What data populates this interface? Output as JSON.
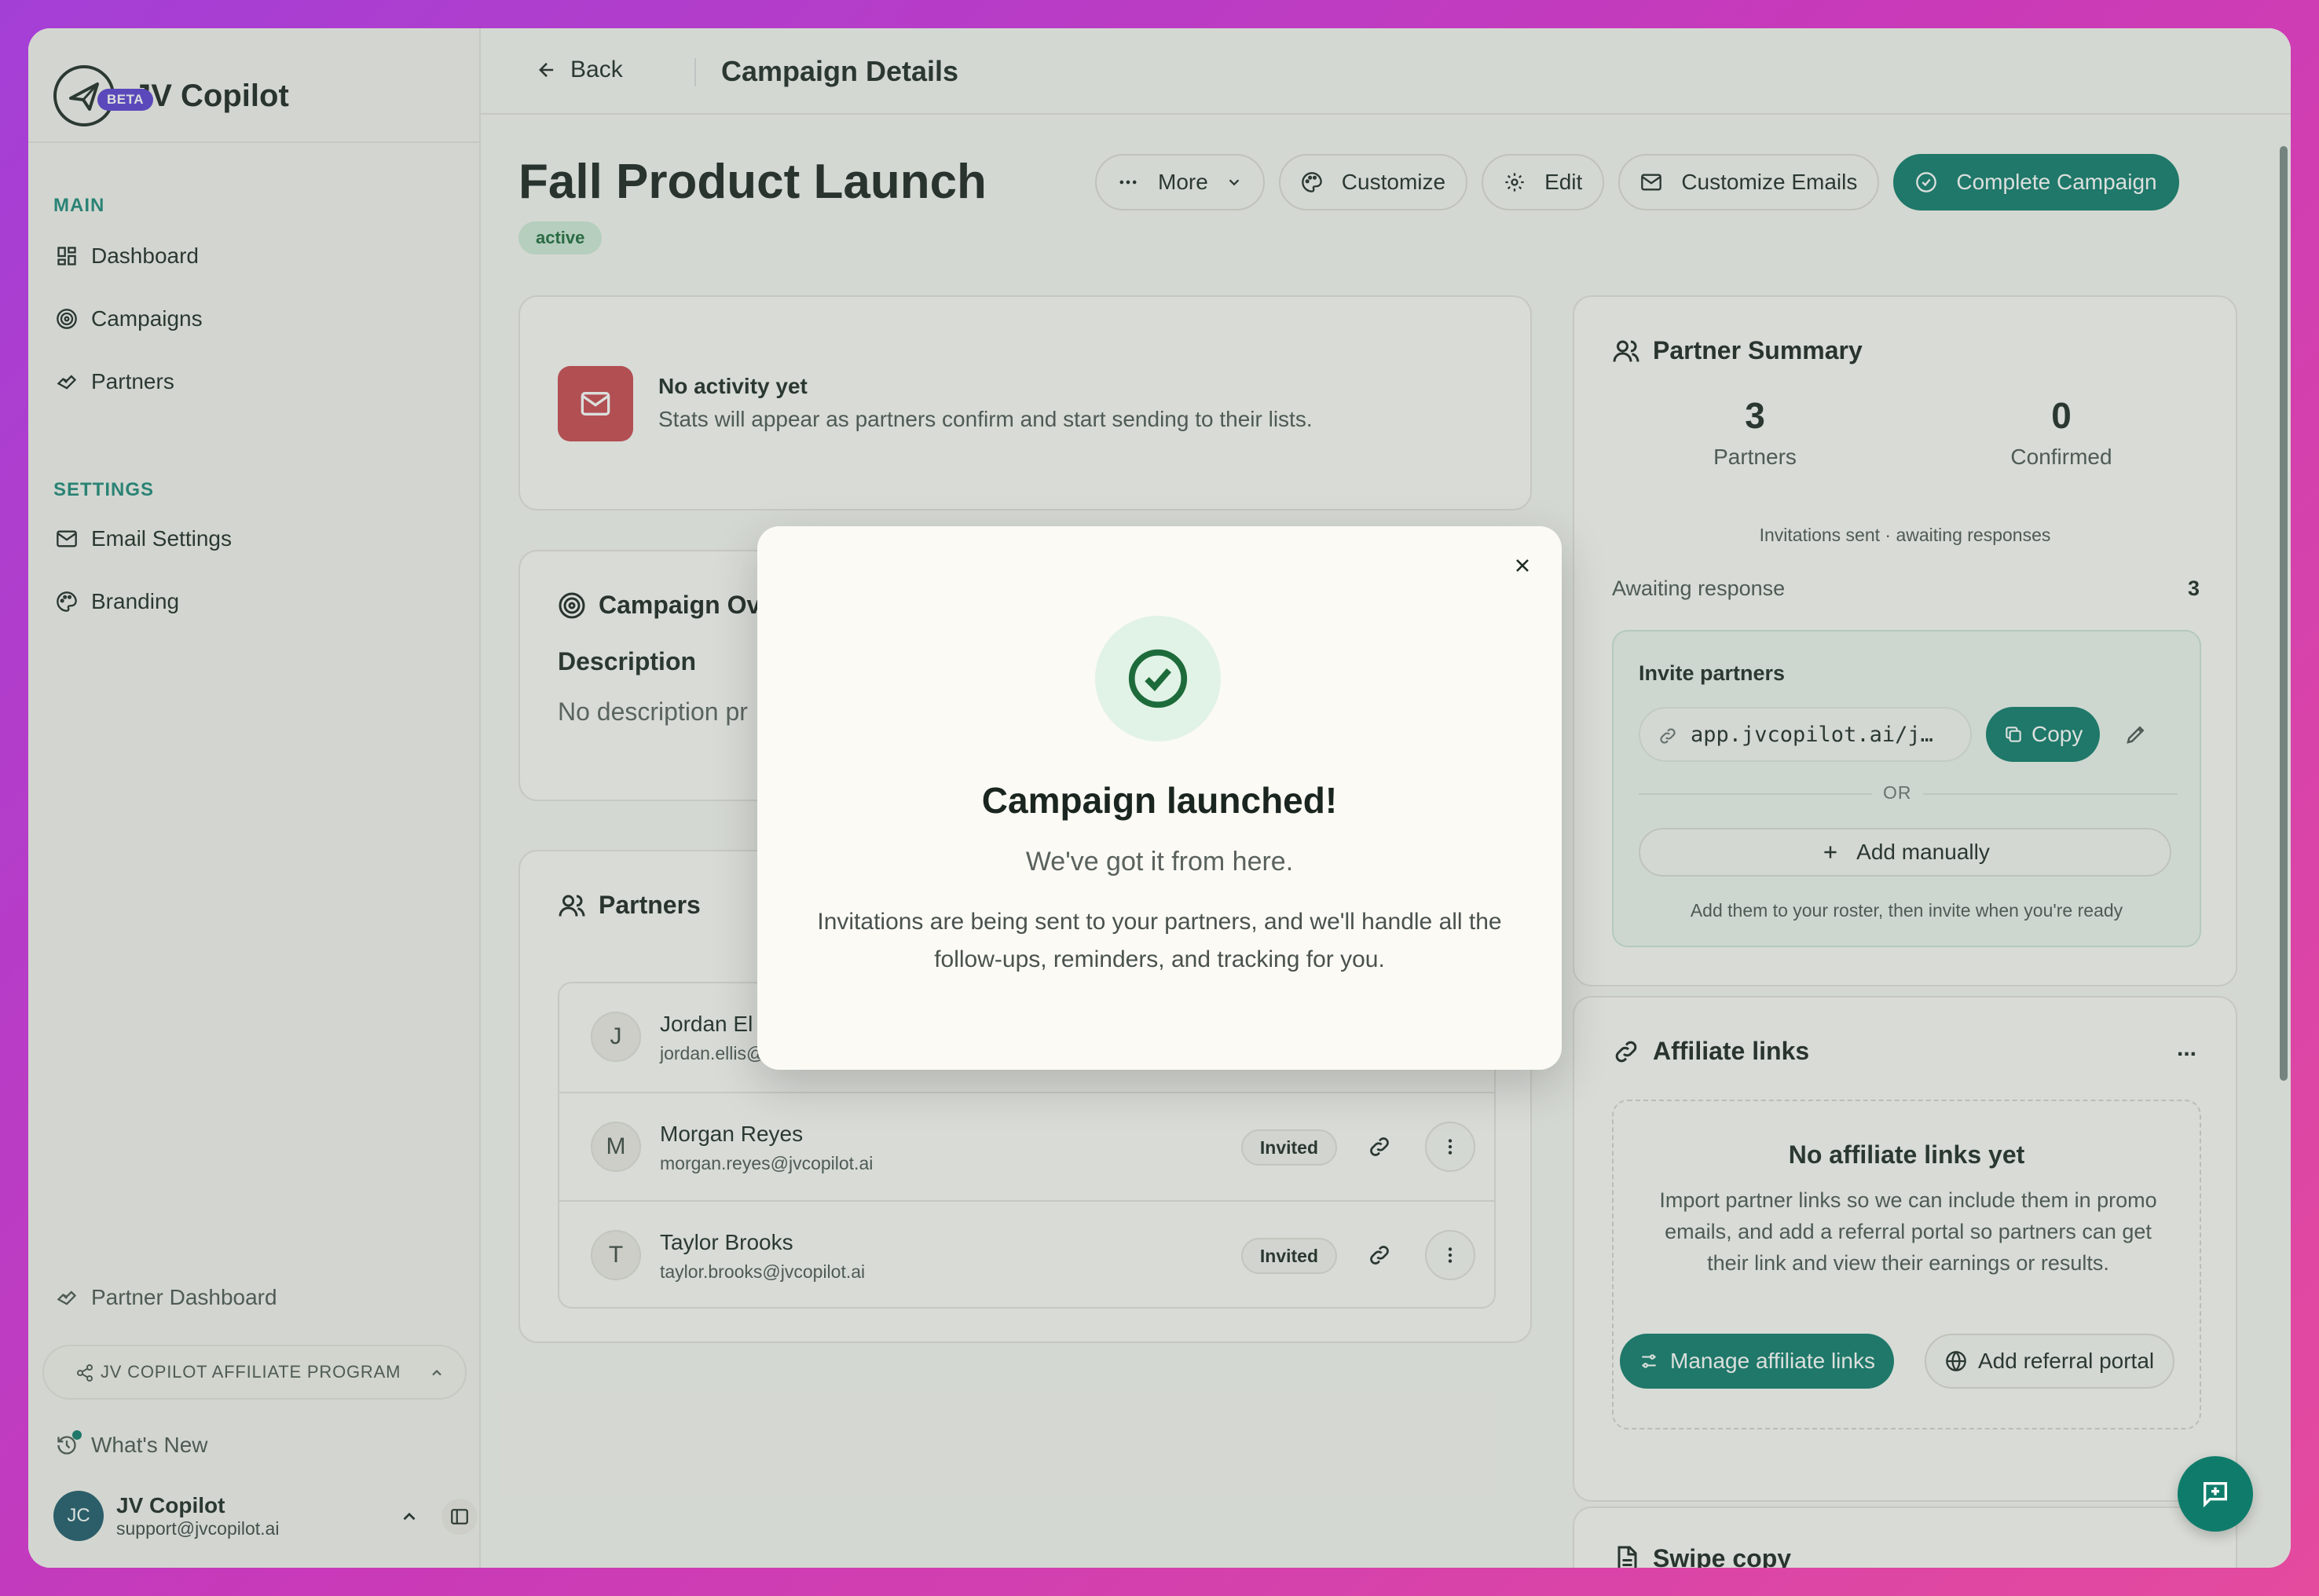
{
  "app": {
    "name": "JV Copilot",
    "beta_label": "BETA"
  },
  "sidebar": {
    "main_section": "MAIN",
    "main_items": [
      {
        "label": "Dashboard",
        "icon": "dashboard-icon"
      },
      {
        "label": "Campaigns",
        "icon": "target-icon"
      },
      {
        "label": "Partners",
        "icon": "handshake-icon"
      }
    ],
    "settings_section": "SETTINGS",
    "settings_items": [
      {
        "label": "Email Settings",
        "icon": "mail-icon"
      },
      {
        "label": "Branding",
        "icon": "palette-icon"
      }
    ],
    "partner_dashboard": "Partner Dashboard",
    "affiliate_program": "JV COPILOT AFFILIATE PROGRAM",
    "whats_new": "What's New",
    "user": {
      "initials": "JC",
      "name": "JV Copilot",
      "email": "support@jvcopilot.ai"
    }
  },
  "topbar": {
    "back_label": "Back",
    "title": "Campaign Details"
  },
  "campaign": {
    "title": "Fall Product Launch",
    "status": "active",
    "actions": {
      "more": "More",
      "customize": "Customize",
      "edit": "Edit",
      "customize_emails": "Customize Emails",
      "complete": "Complete Campaign"
    }
  },
  "activity": {
    "title": "No activity yet",
    "text": "Stats will appear as partners confirm and start sending to their lists."
  },
  "overview": {
    "title": "Campaign Ov",
    "description_label": "Description",
    "description_value": "No description pr"
  },
  "partners": {
    "title": "Partners",
    "rows": [
      {
        "initial": "J",
        "name": "Jordan El",
        "email": "jordan.ellis@",
        "status": ""
      },
      {
        "initial": "M",
        "name": "Morgan Reyes",
        "email": "morgan.reyes@jvcopilot.ai",
        "status": "Invited"
      },
      {
        "initial": "T",
        "name": "Taylor Brooks",
        "email": "taylor.brooks@jvcopilot.ai",
        "status": "Invited"
      }
    ]
  },
  "summary": {
    "title": "Partner Summary",
    "partners_count": "3",
    "partners_label": "Partners",
    "confirmed_count": "0",
    "confirmed_label": "Confirmed",
    "status_note": "Invitations sent · awaiting responses",
    "awaiting_label": "Awaiting response",
    "awaiting_count": "3",
    "invite_title": "Invite partners",
    "invite_link": "app.jvcopilot.ai/j…",
    "copy_label": "Copy",
    "or_label": "OR",
    "add_manually": "Add manually",
    "add_note": "Add them to your roster, then invite when you're ready"
  },
  "affiliate": {
    "title": "Affiliate links",
    "menu_label": "...",
    "empty_title": "No affiliate links yet",
    "empty_text": "Import partner links so we can include them in promo emails, and add a referral portal so partners can get their link and view their earnings or results.",
    "manage_label": "Manage affiliate links",
    "portal_label": "Add referral portal"
  },
  "swipe": {
    "title": "Swipe copy"
  },
  "modal": {
    "title": "Campaign launched!",
    "subtitle": "We've got it from here.",
    "body": "Invitations are being sent to your partners, and we'll handle all the follow-ups, reminders, and tracking for you."
  },
  "colors": {
    "accent": "#0f7c6b",
    "danger": "#c9474f",
    "section": "#1d8a7a"
  }
}
